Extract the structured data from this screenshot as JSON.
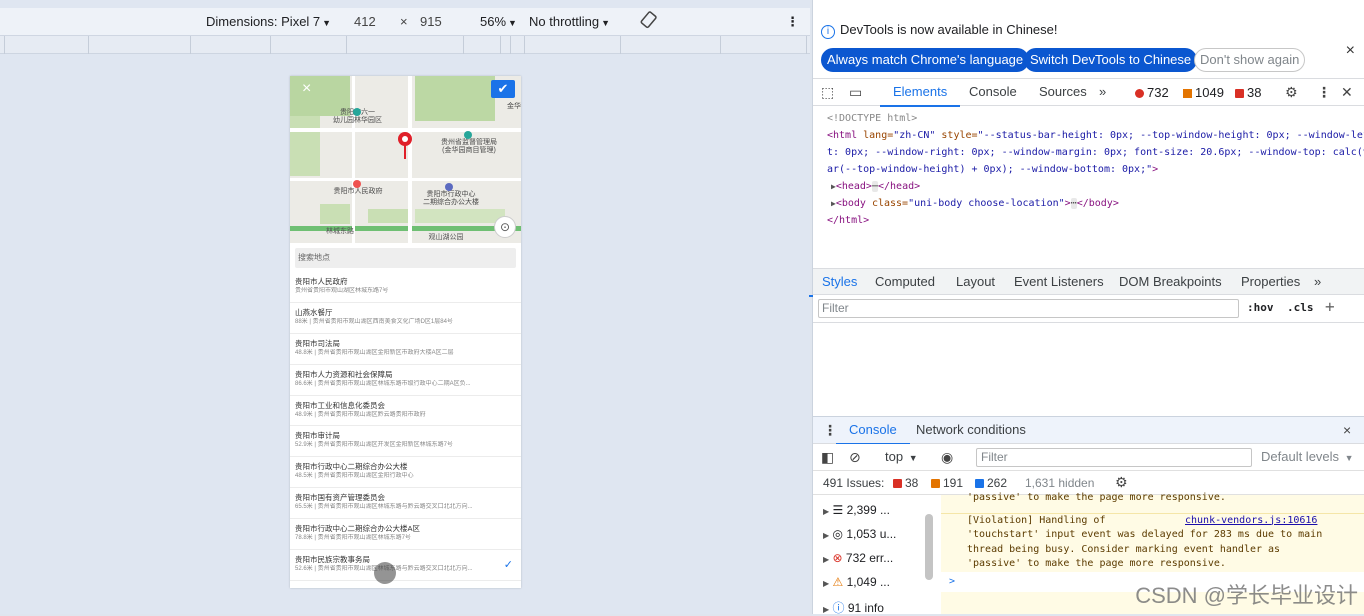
{
  "toolbar": {
    "dimensions": "Dimensions: Pixel 7",
    "width": "412",
    "times": "×",
    "height": "915",
    "zoom": "56%",
    "throttling": "No throttling",
    "more": "⋮"
  },
  "phone": {
    "close": "×",
    "confirm": "✔",
    "locate": "⊙",
    "search_placeholder": "搜索地点",
    "map_labels": {
      "p1": "贵阳市六一\n幼儿园林华园区",
      "p2": "贵州省监督管理局\n(金华园商目管理)",
      "p3": "贵阳市人民政府",
      "p4": "贵阳市行政中心\n二期综合办公大楼",
      "road": "林城东路",
      "park": "观山湖公园",
      "edge": "金华"
    },
    "places": [
      {
        "name": "贵阳市人民政府",
        "addr": "贵州省贵阳市观山湖区林城东路7号"
      },
      {
        "name": "山燕水餐厅",
        "addr": "88米 | 贵州省贵阳市观山湖区西南美食文化广场D区1层84号"
      },
      {
        "name": "贵阳市司法局",
        "addr": "48.8米 | 贵州省贵阳市观山湖区金阳新区市政府大楼A区二层"
      },
      {
        "name": "贵阳市人力资源和社会保障局",
        "addr": "86.6米 | 贵州省贵阳市观山湖区林城东路市级行政中心二期A区负..."
      },
      {
        "name": "贵阳市工业和信息化委员会",
        "addr": "48.9米 | 贵州省贵阳市观山湖区黔云路贵阳市政府"
      },
      {
        "name": "贵阳市审计局",
        "addr": "52.9米 | 贵州省贵阳市观山湖区开发区金阳新区林城东路7号"
      },
      {
        "name": "贵阳市行政中心二期综合办公大楼",
        "addr": "48.5米 | 贵州省贵阳市观山湖区金阳行政中心"
      },
      {
        "name": "贵阳市国有资产管理委员会",
        "addr": "65.5米 | 贵州省贵阳市观山湖区林城东路与黔云路交叉口北北方向..."
      },
      {
        "name": "贵阳市行政中心二期综合办公大楼A区",
        "addr": "78.8米 | 贵州省贵阳市观山湖区林城东路7号"
      },
      {
        "name": "贵阳市民族宗教事务局",
        "addr": "52.6米 | 贵州省贵阳市观山湖区林城东路与黔云路交叉口北北方向..."
      }
    ],
    "selected_check": "✓"
  },
  "devtools": {
    "banner": {
      "info": "i",
      "title": "DevTools is now available in Chinese!",
      "btn_match": "Always match Chrome's language",
      "btn_switch": "Switch DevTools to Chinese",
      "btn_dont": "Don't show again",
      "close": "×"
    },
    "main_tabs": [
      "Elements",
      "Console",
      "Sources",
      "»"
    ],
    "counts": {
      "errors": "732",
      "warnings": "1049",
      "issues": "38"
    },
    "code": {
      "doctype": "<!DOCTYPE html>",
      "html_open_1a": "<html",
      "html_attr_lang": " lang=",
      "html_val_lang": "\"zh-CN\"",
      "html_attr_style": " style=",
      "html_val_style_1": "\"--status-bar-height: 0px; --top-window-height: 0px; --window-lef",
      "html_val_style_2": "t: 0px; --window-right: 0px; --window-margin: 0px; font-size: 20.6px; --window-top: calc(v",
      "html_val_style_3": "ar(--top-window-height) + 0px); --window-bottom: 0px;\"",
      "html_open_end": ">",
      "head_line": "<head>",
      "head_close": "</head>",
      "body_open": "<body",
      "body_attr": " class=",
      "body_val": "\"uni-body choose-location\"",
      "body_close": "</body>",
      "html_close": "</html>",
      "ellipsis": "⋯"
    },
    "style_tabs": [
      "Styles",
      "Computed",
      "Layout",
      "Event Listeners",
      "DOM Breakpoints",
      "Properties",
      "»"
    ],
    "filter_placeholder": "Filter",
    "hov": ":hov",
    "cls": ".cls",
    "plus": "+",
    "drawer": {
      "tab_console": "Console",
      "tab_network": "Network conditions",
      "close": "×"
    },
    "console_toolbar": {
      "context": "top",
      "filter_placeholder": "Filter",
      "levels": "Default levels"
    },
    "issues_bar": {
      "label": "491 Issues:",
      "errors": "38",
      "warnings": "191",
      "info": "262",
      "hidden": "1,631 hidden"
    },
    "sidebar": [
      {
        "icon": "list",
        "count": "2,399 ..."
      },
      {
        "icon": "user",
        "count": "1,053 u..."
      },
      {
        "icon": "error",
        "count": "732 err..."
      },
      {
        "icon": "warning",
        "count": "1,049 ..."
      },
      {
        "icon": "info",
        "count": "91 info"
      }
    ],
    "messages": {
      "prev_tail": "'passive' to make the page more responsive.",
      "violation_1": "[Violation] Handling of",
      "violation_link": "chunk-vendors.js:10616",
      "violation_2": "'touchstart' input event was delayed for 283 ms due to main",
      "violation_3": "thread being busy. Consider marking event handler as",
      "violation_4": "'passive' to make the page more responsive.",
      "prompt": ">"
    }
  },
  "watermark": "CSDN @学长毕业设计"
}
